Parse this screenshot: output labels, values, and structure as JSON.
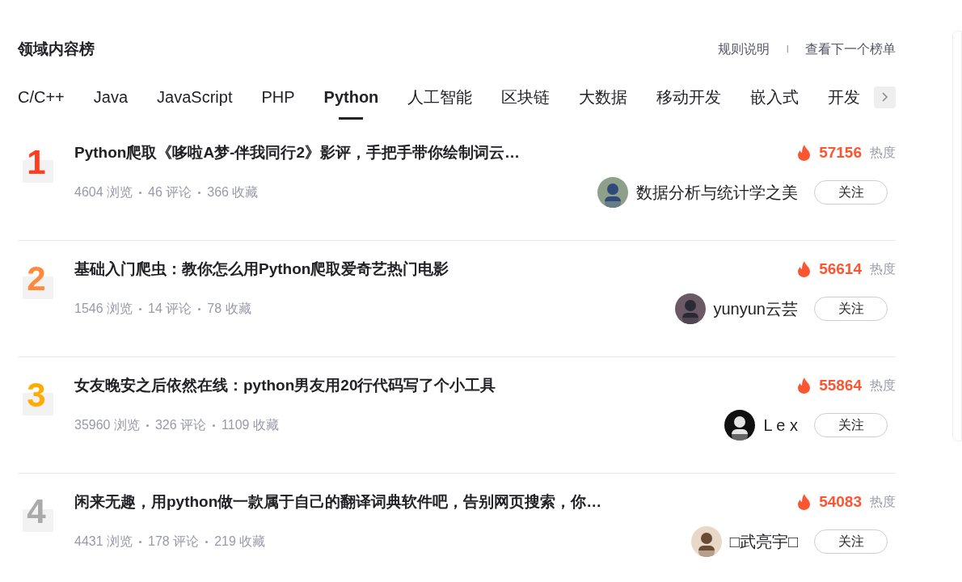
{
  "header": {
    "title": "领域内容榜",
    "links": [
      "规则说明",
      "查看下一个榜单"
    ],
    "separator": "I"
  },
  "tabs": [
    {
      "label": "C/C++",
      "selected": false
    },
    {
      "label": "Java",
      "selected": false
    },
    {
      "label": "JavaScript",
      "selected": false
    },
    {
      "label": "PHP",
      "selected": false
    },
    {
      "label": "Python",
      "selected": true
    },
    {
      "label": "人工智能",
      "selected": false
    },
    {
      "label": "区块链",
      "selected": false
    },
    {
      "label": "大数据",
      "selected": false
    },
    {
      "label": "移动开发",
      "selected": false
    },
    {
      "label": "嵌入式",
      "selected": false
    },
    {
      "label": "开发",
      "selected": false
    }
  ],
  "articles": [
    {
      "rank": "1",
      "color": "#ff3d1f",
      "title": "Python爬取《哆啦A梦-伴我同行2》影评，手把手带你绘制词云…",
      "views": "4604 浏览",
      "comments": "46 评论",
      "favorites": "366 收藏",
      "heat": "57156",
      "heat_label": "热度",
      "author": "数据分析与统计学之美",
      "follow": "关注"
    },
    {
      "rank": "2",
      "color": "#ff8a3d",
      "title": "基础入门爬虫：教你怎么用Python爬取爱奇艺热门电影",
      "views": "1546 浏览",
      "comments": "14 评论",
      "favorites": "78 收藏",
      "heat": "56614",
      "heat_label": "热度",
      "author": "yunyun云芸",
      "follow": "关注"
    },
    {
      "rank": "3",
      "color": "#ffab00",
      "title": "女友晚安之后依然在线：python男友用20行代码写了个小工具",
      "views": "35960 浏览",
      "comments": "326 评论",
      "favorites": "1109 收藏",
      "heat": "55864",
      "heat_label": "热度",
      "author": "L e x",
      "follow": "关注"
    },
    {
      "rank": "4",
      "color": "#aaaaaa",
      "title": "闲来无趣，用python做一款属于自己的翻译词典软件吧，告别网页搜索，你…",
      "views": "4431 浏览",
      "comments": "178 评论",
      "favorites": "219 收藏",
      "heat": "54083",
      "heat_label": "热度",
      "author": "□武亮宇□",
      "follow": "关注"
    }
  ]
}
